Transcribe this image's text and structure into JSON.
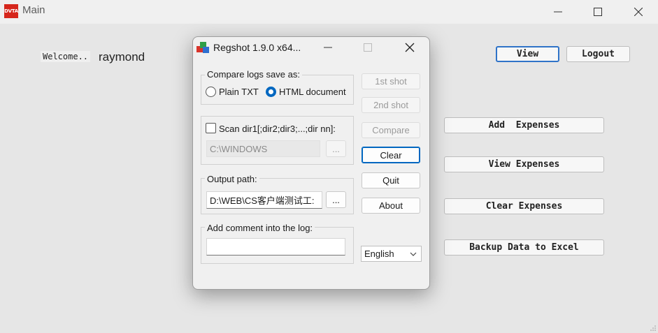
{
  "main_window": {
    "title": "Main",
    "logo_text": "DVTA",
    "welcome_label": "Welcome..",
    "username": "raymond",
    "view_label": "View",
    "logout_label": "Logout",
    "add_expenses_label": "Add  Expenses",
    "view_expenses_label": "View Expenses",
    "clear_expenses_label": "Clear Expenses",
    "backup_label": "Backup Data to Excel",
    "icons": [
      "minimize-icon",
      "maximize-icon",
      "close-icon"
    ]
  },
  "regshot": {
    "title": "Regshot 1.9.0 x64...",
    "compare_group_label": "Compare logs save as:",
    "option_plain": "Plain TXT",
    "option_html": "HTML document",
    "selected_option": "HTML document",
    "scan_label": "Scan dir1[;dir2;dir3;...;dir nn]:",
    "scan_checked": false,
    "scan_dir_value": "C:\\WINDOWS",
    "browse_label": "...",
    "output_path_label": "Output path:",
    "output_path_value": "D:\\WEB\\CS客户端测试工:",
    "comment_label": "Add comment into the log:",
    "comment_value": "",
    "first_shot_label": "1st shot",
    "second_shot_label": "2nd shot",
    "compare_label": "Compare",
    "clear_label": "Clear",
    "quit_label": "Quit",
    "about_label": "About",
    "language": "English",
    "accent_color": "#0067c0"
  }
}
